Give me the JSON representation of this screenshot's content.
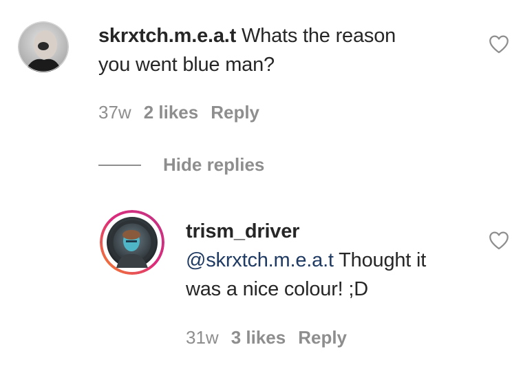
{
  "comments": [
    {
      "username": "skrxtch.m.e.a.t",
      "text_line1": "Whats the reason",
      "text_line2": "you went blue man?",
      "time": "37w",
      "likes": "2 likes",
      "reply_label": "Reply"
    }
  ],
  "replies_toggle": {
    "label": "Hide replies"
  },
  "replies": [
    {
      "username": "trism_driver",
      "mention": "@skrxtch.m.e.a.t",
      "text_line1": "Thought it",
      "text_line2": "was a nice colour! ;D",
      "time": "31w",
      "likes": "3 likes",
      "reply_label": "Reply"
    }
  ],
  "icons": {
    "like": "heart-outline-icon"
  },
  "colors": {
    "text": "#262626",
    "secondary": "#8e8e8e",
    "mention": "#1f3a63",
    "story_ring_start": "#f58529",
    "story_ring_end": "#c13584"
  }
}
